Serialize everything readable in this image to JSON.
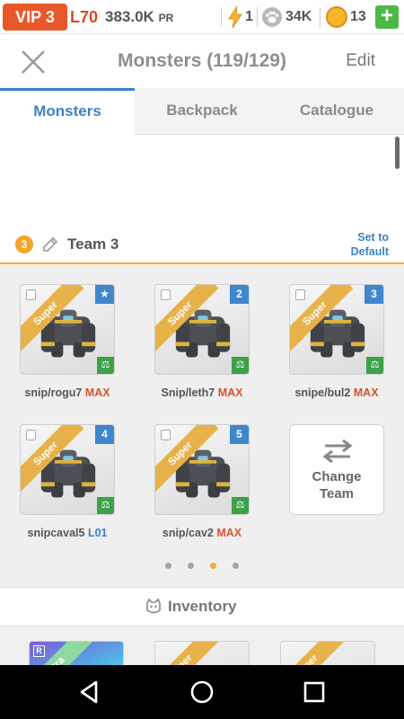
{
  "status": {
    "vip": "VIP 3",
    "level": "L70",
    "power": "383.0K",
    "power_unit": "PR",
    "energy": "1",
    "paws": "34K",
    "coins": "13",
    "plus": "+"
  },
  "header": {
    "title": "Monsters (119/129)",
    "edit": "Edit"
  },
  "tabs": [
    {
      "label": "Monsters",
      "active": true
    },
    {
      "label": "Backpack",
      "active": false
    },
    {
      "label": "Catalogue",
      "active": false
    }
  ],
  "team": {
    "number": "3",
    "name": "Team 3",
    "set_default_line1": "Set to",
    "set_default_line2": "Default"
  },
  "monsters": [
    {
      "name": "snip/rogu7",
      "level": "MAX",
      "badge": "★",
      "ribbon": "Super"
    },
    {
      "name": "Snip/leth7",
      "level": "MAX",
      "badge": "2",
      "ribbon": "Super"
    },
    {
      "name": "snipe/bul2",
      "level": "MAX",
      "badge": "3",
      "ribbon": "Super"
    },
    {
      "name": "snipcaval5",
      "level": "L01",
      "badge": "4",
      "ribbon": "Super"
    },
    {
      "name": "snip/cav2",
      "level": "MAX",
      "badge": "5",
      "ribbon": "Super"
    }
  ],
  "change_team": {
    "line1": "Change",
    "line2": "Team"
  },
  "pager": {
    "count": 4,
    "active_index": 2
  },
  "inventory": {
    "title": "Inventory",
    "cards": [
      {
        "tag": "R",
        "ribbon": "Ultra"
      },
      {
        "tag": "",
        "ribbon": "Super"
      },
      {
        "tag": "",
        "ribbon": "Super"
      }
    ]
  },
  "colors": {
    "accent_blue": "#3b82c4",
    "vip_orange": "#e8572a",
    "max_red": "#d9512b",
    "team_orange": "#f1ad3a",
    "plus_green": "#4cb848"
  }
}
